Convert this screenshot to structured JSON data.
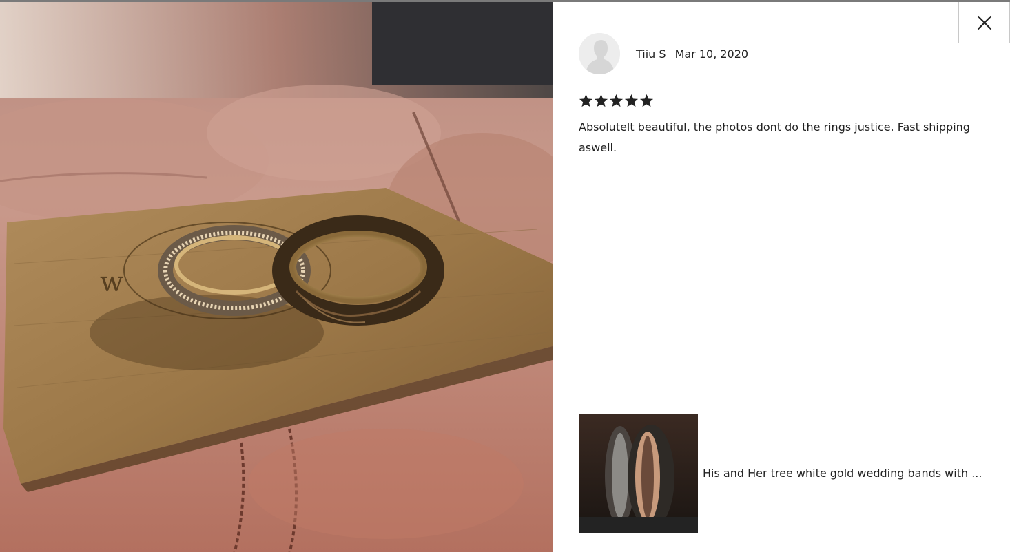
{
  "review_photo": {
    "alt": "Customer photo: two wedding rings on an engraved wooden card"
  },
  "close_button": {
    "label": "Close",
    "icon": "close-icon"
  },
  "reviewer": {
    "avatar_icon": "default-user-avatar",
    "name": "Tiiu S",
    "date": "Mar 10, 2020"
  },
  "rating": {
    "value": 5,
    "max": 5,
    "star_color": "#222222"
  },
  "review": {
    "text": "Absolutelt beautiful, the photos dont do the rings justice. Fast shipping aswell."
  },
  "product": {
    "thumbnail_alt": "His and Her tree white gold wedding bands",
    "title": "His and Her tree white gold wedding bands with ..."
  }
}
